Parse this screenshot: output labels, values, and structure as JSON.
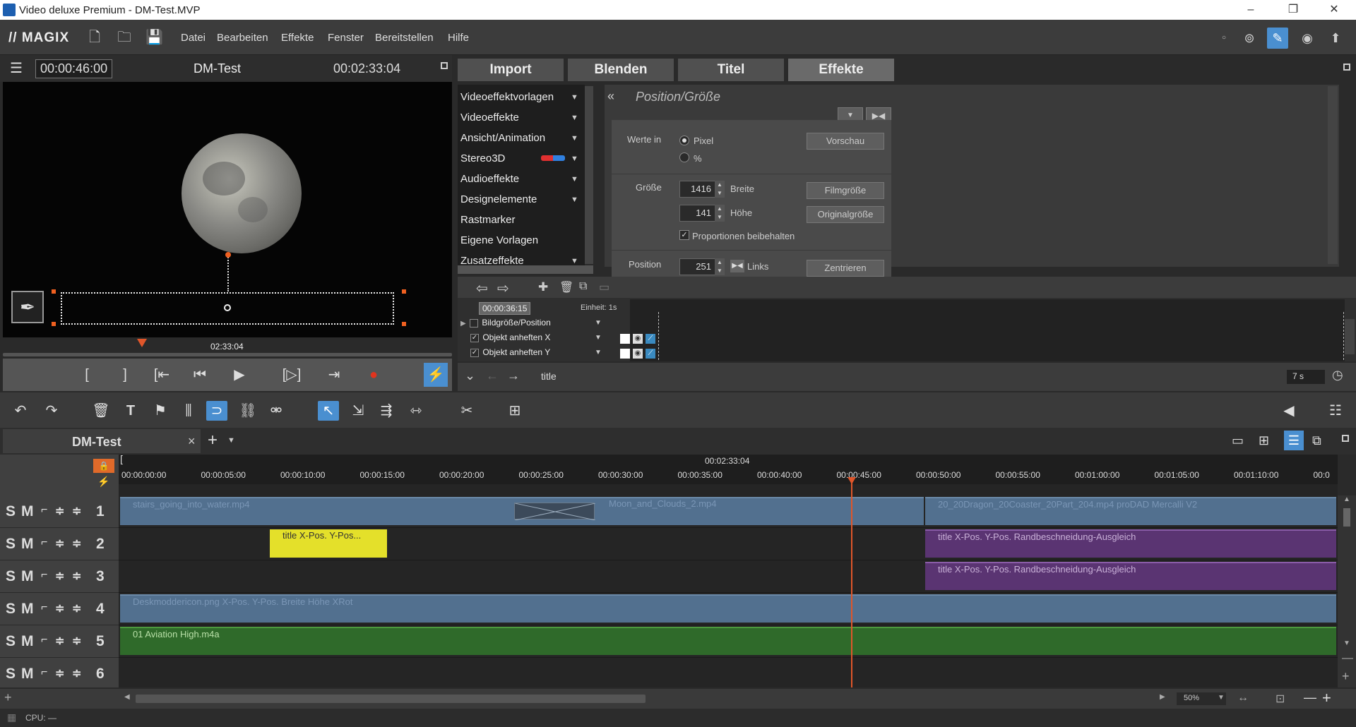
{
  "window": {
    "title": "Video deluxe Premium - DM-Test.MVP",
    "minimize": "–",
    "maximize": "❐",
    "close": "✕"
  },
  "menubar": {
    "logo": "// MAGIX",
    "items": [
      "Datei",
      "Bearbeiten",
      "Effekte",
      "Fenster",
      "Bereitstellen",
      "Hilfe"
    ]
  },
  "preview": {
    "position": "00:00:46:00",
    "project": "DM-Test",
    "duration": "00:02:33:04",
    "ruler_time": "02:33:04"
  },
  "media_tabs": [
    "Import",
    "Blenden",
    "Titel",
    "Effekte"
  ],
  "categories": [
    "Videoeffektvorlagen",
    "Videoeffekte",
    "Ansicht/Animation",
    "Stereo3D",
    "Audioeffekte",
    "Designelemente",
    "Rastmarker",
    "Eigene Vorlagen",
    "Zusatzeffekte"
  ],
  "effect_panel": {
    "title": "Position/Größe",
    "values_in_label": "Werte in",
    "unit_pixel": "Pixel",
    "unit_percent": "%",
    "preview_btn": "Vorschau",
    "size_label": "Größe",
    "width_value": "1416",
    "width_label": "Breite",
    "height_value": "141",
    "height_label": "Höhe",
    "film_size_btn": "Filmgröße",
    "original_size_btn": "Originalgröße",
    "keep_proportions": "Proportionen beibehalten",
    "position_label": "Position",
    "left_value": "251",
    "left_label": "Links",
    "center_btn": "Zentrieren"
  },
  "keyframes": {
    "time": "00:00:36:15",
    "unit": "Einheit: 1s",
    "rows": [
      "Bildgröße/Position",
      "Objekt anheften X",
      "Objekt anheften Y"
    ],
    "nav_label": "title",
    "duration": "7 s"
  },
  "arrangement": {
    "tab": "DM-Test",
    "close": "×",
    "add": "+",
    "timecode": "00:02:33:04"
  },
  "ruler_ticks": [
    "00:00:00:00",
    "00:00:05:00",
    "00:00:10:00",
    "00:00:15:00",
    "00:00:20:00",
    "00:00:25:00",
    "00:00:30:00",
    "00:00:35:00",
    "00:00:40:00",
    "00:00:45:00",
    "00:00:50:00",
    "00:00:55:00",
    "00:01:00:00",
    "00:01:05:00",
    "00:01:10:00",
    "00:0"
  ],
  "tracks": [
    {
      "num": "1"
    },
    {
      "num": "2"
    },
    {
      "num": "3"
    },
    {
      "num": "4"
    },
    {
      "num": "5"
    },
    {
      "num": "6"
    }
  ],
  "track_controls": {
    "solo": "S",
    "mute": "M"
  },
  "clips": {
    "stairs": "stairs_going_into_water.mp4",
    "moon": "Moon_and_Clouds_2.mp4",
    "dragon": "20_20Dragon_20Coaster_20Part_204.mp4  proDAD Mercalli V2",
    "title_yellow": "title  X-Pos.  Y-Pos...",
    "title_purple_2": "title  X-Pos.  Y-Pos.  Randbeschneidung-Ausgleich",
    "title_purple_3": "title  X-Pos.  Y-Pos.  Randbeschneidung-Ausgleich",
    "desk": "Deskmoddericon.png  X-Pos.  Y-Pos.  Breite  Höhe  XRot",
    "audio": "01 Aviation High.m4a"
  },
  "bottom": {
    "zoom": "50%",
    "cpu": "CPU: —"
  }
}
